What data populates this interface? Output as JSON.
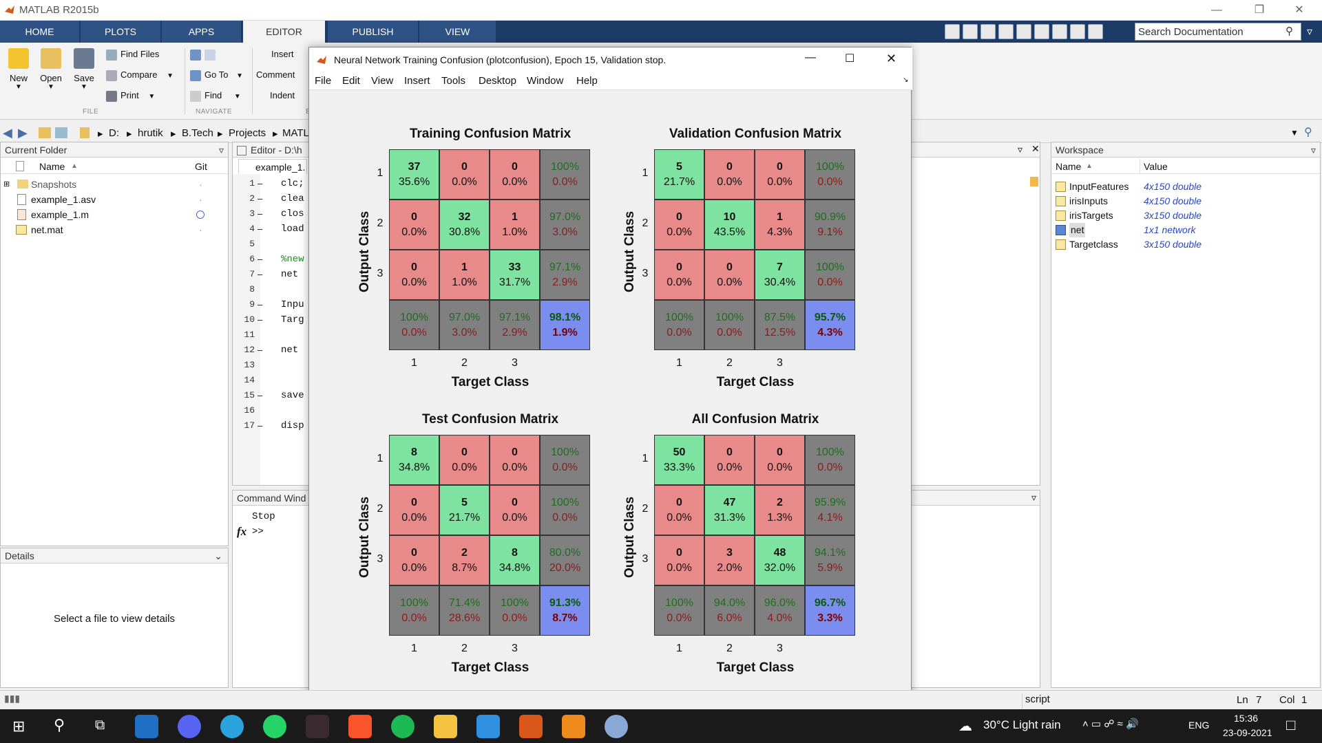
{
  "app": {
    "title": "MATLAB R2015b"
  },
  "ribbon_tabs": [
    {
      "label": "HOME"
    },
    {
      "label": "PLOTS"
    },
    {
      "label": "APPS"
    },
    {
      "label": "EDITOR"
    },
    {
      "label": "PUBLISH"
    },
    {
      "label": "VIEW"
    }
  ],
  "search": {
    "placeholder": "Search Documentation"
  },
  "ribbon": {
    "new": "New",
    "open": "Open",
    "save": "Save",
    "find_files": "Find Files",
    "compare": "Compare",
    "print": "Print",
    "go_to": "Go To",
    "find": "Find",
    "insert": "Insert",
    "comment": "Comment",
    "indent": "Indent",
    "group_file": "FILE",
    "group_navigate": "NAVIGATE",
    "group_e": "E"
  },
  "address": {
    "crumbs": [
      "D:",
      "hrutik",
      "B.Tech",
      "Projects",
      "MATL"
    ]
  },
  "current_folder": {
    "title": "Current Folder",
    "col_name": "Name",
    "col_git": "Git",
    "items": [
      {
        "name": "Snapshots"
      },
      {
        "name": "example_1.asv"
      },
      {
        "name": "example_1.m"
      },
      {
        "name": "net.mat"
      }
    ]
  },
  "details": {
    "title": "Details",
    "message": "Select a file to view details"
  },
  "editor": {
    "title": "Editor - D:\\h",
    "tab": "example_1.",
    "line_numbers": [
      "1",
      "2",
      "3",
      "4",
      "5",
      "6",
      "7",
      "8",
      "9",
      "10",
      "11",
      "12",
      "13",
      "14",
      "15",
      "16",
      "17"
    ],
    "lines": [
      "clc;",
      "clea",
      "clos",
      "load",
      "",
      "%new",
      "net",
      "",
      "Inpu",
      "Targ",
      "",
      "net",
      "",
      "",
      "save",
      "",
      "disp"
    ]
  },
  "command_window": {
    "title": "Command Wind",
    "output": "Stop",
    "prompt": ">>",
    "fx": "fx"
  },
  "workspace": {
    "title": "Workspace",
    "col_name": "Name",
    "col_value": "Value",
    "items": [
      {
        "name": "InputFeatures",
        "value": "4x150 double"
      },
      {
        "name": "irisInputs",
        "value": "4x150 double"
      },
      {
        "name": "irisTargets",
        "value": "3x150 double"
      },
      {
        "name": "net",
        "value": "1x1 network"
      },
      {
        "name": "Targetclass",
        "value": "3x150 double"
      }
    ]
  },
  "figure": {
    "title": "Neural Network Training Confusion (plotconfusion), Epoch 15, Validation stop.",
    "menu": [
      "File",
      "Edit",
      "View",
      "Insert",
      "Tools",
      "Desktop",
      "Window",
      "Help"
    ]
  },
  "chart_data": [
    {
      "type": "heatmap",
      "title": "Training Confusion Matrix",
      "xlabel": "Target Class",
      "ylabel": "Output Class",
      "x_ticks": [
        "1",
        "2",
        "3"
      ],
      "y_ticks": [
        "1",
        "2",
        "3"
      ],
      "counts": [
        [
          "37",
          "0",
          "0"
        ],
        [
          "0",
          "32",
          "1"
        ],
        [
          "0",
          "1",
          "33"
        ]
      ],
      "percents": [
        [
          "35.6%",
          "0.0%",
          "0.0%"
        ],
        [
          "0.0%",
          "30.8%",
          "1.0%"
        ],
        [
          "0.0%",
          "1.0%",
          "31.7%"
        ]
      ],
      "row_summary": [
        [
          "100%",
          "0.0%"
        ],
        [
          "97.0%",
          "3.0%"
        ],
        [
          "97.1%",
          "2.9%"
        ]
      ],
      "col_summary": [
        [
          "100%",
          "0.0%"
        ],
        [
          "97.0%",
          "3.0%"
        ],
        [
          "97.1%",
          "2.9%"
        ]
      ],
      "overall": [
        "98.1%",
        "1.9%"
      ]
    },
    {
      "type": "heatmap",
      "title": "Validation Confusion Matrix",
      "xlabel": "Target Class",
      "ylabel": "Output Class",
      "x_ticks": [
        "1",
        "2",
        "3"
      ],
      "y_ticks": [
        "1",
        "2",
        "3"
      ],
      "counts": [
        [
          "5",
          "0",
          "0"
        ],
        [
          "0",
          "10",
          "1"
        ],
        [
          "0",
          "0",
          "7"
        ]
      ],
      "percents": [
        [
          "21.7%",
          "0.0%",
          "0.0%"
        ],
        [
          "0.0%",
          "43.5%",
          "4.3%"
        ],
        [
          "0.0%",
          "0.0%",
          "30.4%"
        ]
      ],
      "row_summary": [
        [
          "100%",
          "0.0%"
        ],
        [
          "90.9%",
          "9.1%"
        ],
        [
          "100%",
          "0.0%"
        ]
      ],
      "col_summary": [
        [
          "100%",
          "0.0%"
        ],
        [
          "100%",
          "0.0%"
        ],
        [
          "87.5%",
          "12.5%"
        ]
      ],
      "overall": [
        "95.7%",
        "4.3%"
      ]
    },
    {
      "type": "heatmap",
      "title": "Test Confusion Matrix",
      "xlabel": "Target Class",
      "ylabel": "Output Class",
      "x_ticks": [
        "1",
        "2",
        "3"
      ],
      "y_ticks": [
        "1",
        "2",
        "3"
      ],
      "counts": [
        [
          "8",
          "0",
          "0"
        ],
        [
          "0",
          "5",
          "0"
        ],
        [
          "0",
          "2",
          "8"
        ]
      ],
      "percents": [
        [
          "34.8%",
          "0.0%",
          "0.0%"
        ],
        [
          "0.0%",
          "21.7%",
          "0.0%"
        ],
        [
          "0.0%",
          "8.7%",
          "34.8%"
        ]
      ],
      "row_summary": [
        [
          "100%",
          "0.0%"
        ],
        [
          "100%",
          "0.0%"
        ],
        [
          "80.0%",
          "20.0%"
        ]
      ],
      "col_summary": [
        [
          "100%",
          "0.0%"
        ],
        [
          "71.4%",
          "28.6%"
        ],
        [
          "100%",
          "0.0%"
        ]
      ],
      "overall": [
        "91.3%",
        "8.7%"
      ]
    },
    {
      "type": "heatmap",
      "title": "All Confusion Matrix",
      "xlabel": "Target Class",
      "ylabel": "Output Class",
      "x_ticks": [
        "1",
        "2",
        "3"
      ],
      "y_ticks": [
        "1",
        "2",
        "3"
      ],
      "counts": [
        [
          "50",
          "0",
          "0"
        ],
        [
          "0",
          "47",
          "2"
        ],
        [
          "0",
          "3",
          "48"
        ]
      ],
      "percents": [
        [
          "33.3%",
          "0.0%",
          "0.0%"
        ],
        [
          "0.0%",
          "31.3%",
          "1.3%"
        ],
        [
          "0.0%",
          "2.0%",
          "32.0%"
        ]
      ],
      "row_summary": [
        [
          "100%",
          "0.0%"
        ],
        [
          "95.9%",
          "4.1%"
        ],
        [
          "94.1%",
          "5.9%"
        ]
      ],
      "col_summary": [
        [
          "100%",
          "0.0%"
        ],
        [
          "94.0%",
          "6.0%"
        ],
        [
          "96.0%",
          "4.0%"
        ]
      ],
      "overall": [
        "96.7%",
        "3.3%"
      ]
    }
  ],
  "statusbar": {
    "mode": "script",
    "ln": "Ln",
    "ln_val": "7",
    "col": "Col",
    "col_val": "1"
  },
  "taskbar": {
    "weather": "30°C  Light rain",
    "lang": "ENG",
    "time": "15:36",
    "date": "23-09-2021"
  }
}
